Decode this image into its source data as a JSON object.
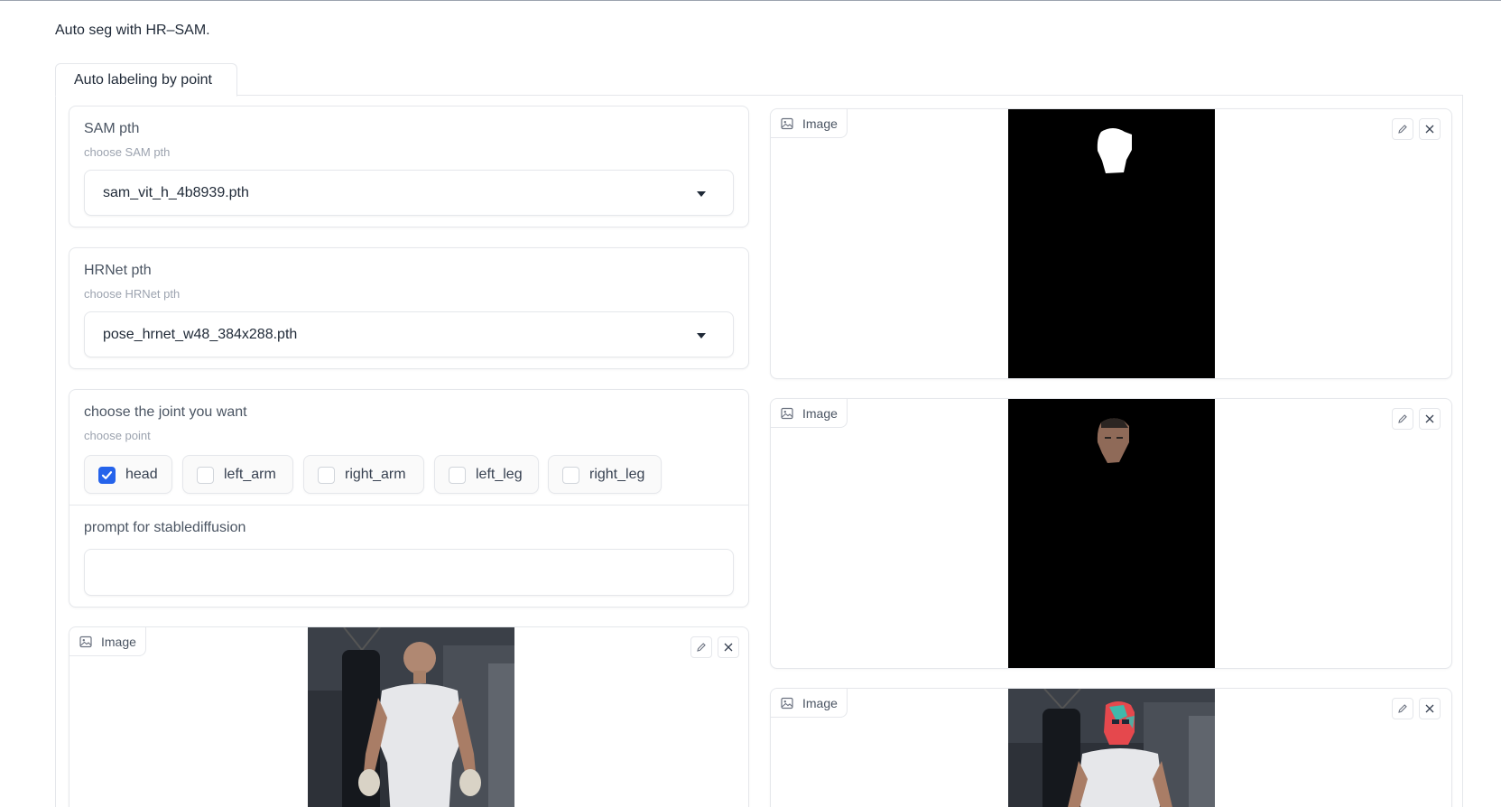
{
  "description": "Auto seg with HR–SAM.",
  "tabs": [
    {
      "label": "Auto labeling by point"
    }
  ],
  "sam": {
    "label": "SAM pth",
    "info": "choose SAM pth",
    "value": "sam_vit_h_4b8939.pth"
  },
  "hrnet": {
    "label": "HRNet pth",
    "info": "choose HRNet pth",
    "value": "pose_hrnet_w48_384x288.pth"
  },
  "joints": {
    "label": "choose the joint you want",
    "info": "choose point",
    "options": [
      {
        "label": "head",
        "checked": true
      },
      {
        "label": "left_arm",
        "checked": false
      },
      {
        "label": "right_arm",
        "checked": false
      },
      {
        "label": "left_leg",
        "checked": false
      },
      {
        "label": "right_leg",
        "checked": false
      }
    ]
  },
  "prompt": {
    "label": "prompt for stablediffusion",
    "value": ""
  },
  "image_label": "Image",
  "colors": {
    "accent": "#2563eb",
    "border": "#e5e7eb",
    "mask_bg": "#000000",
    "overlay": "#e5484d",
    "overlay2": "#2ec4b6"
  }
}
